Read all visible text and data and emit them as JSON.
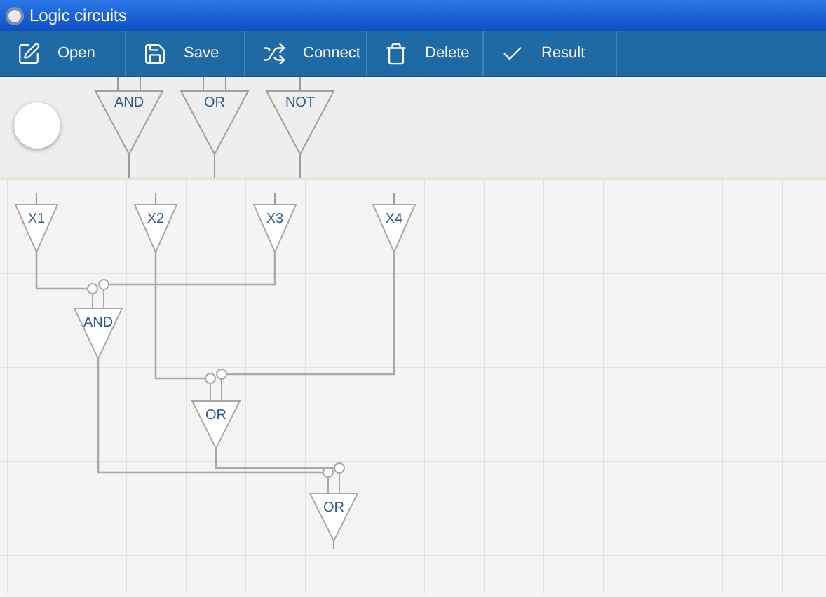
{
  "window": {
    "title": "Logic circuits"
  },
  "toolbar": [
    {
      "label": "Open",
      "kind": "open"
    },
    {
      "label": "Save",
      "kind": "save"
    },
    {
      "label": "Connect",
      "kind": "connect"
    },
    {
      "label": "Delete",
      "kind": "delete"
    },
    {
      "label": "Result",
      "kind": "result"
    }
  ],
  "palette": [
    {
      "label": "AND",
      "kind": "binary"
    },
    {
      "label": "OR",
      "kind": "binary"
    },
    {
      "label": "NOT",
      "kind": "unary"
    }
  ],
  "circuit": [
    {
      "label": "X1",
      "kind": "input"
    },
    {
      "label": "X2",
      "kind": "input"
    },
    {
      "label": "X3",
      "kind": "input"
    },
    {
      "label": "X4",
      "kind": "input"
    },
    {
      "label": "AND",
      "kind": "gate"
    },
    {
      "label": "OR",
      "kind": "gate"
    },
    {
      "label": "OR",
      "kind": "gate"
    }
  ]
}
